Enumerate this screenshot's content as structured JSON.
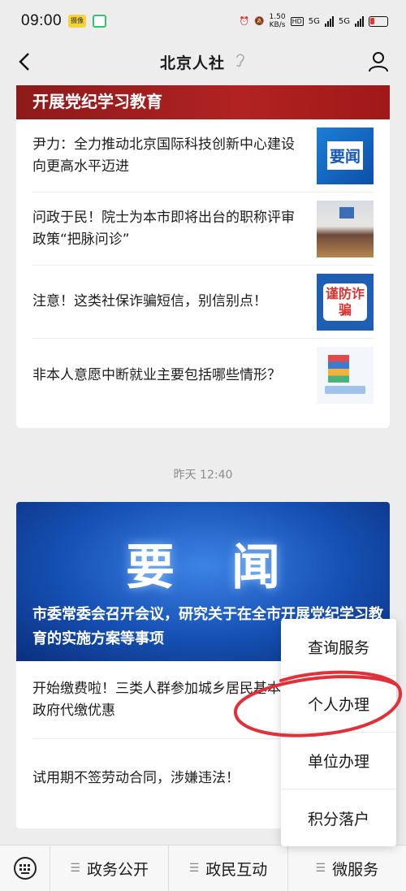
{
  "status_bar": {
    "time": "09:00",
    "chip_label": "摄像",
    "net_speed_value": "1.50",
    "net_speed_unit": "KB/s",
    "hd_label": "HD",
    "signal1_label": "5G",
    "signal2_label": "5G"
  },
  "header": {
    "title": "北京人社"
  },
  "card1": {
    "banner_text": "开展党纪学习教育",
    "items": [
      {
        "title": "尹力：全力推动北京国际科技创新中心建设向更高水平迈进",
        "thumb_label": "要闻"
      },
      {
        "title": "问政于民！院士为本市即将出台的职称评审政策“把脉问诊”"
      },
      {
        "title": "注意！这类社保诈骗短信，别信别点！",
        "thumb_label": "谨防诈骗"
      },
      {
        "title": "非本人意愿中断就业主要包括哪些情形？"
      }
    ]
  },
  "timestamp": "昨天 12:40",
  "card2": {
    "banner_big": "要闻",
    "banner_title": "市委常委会召开会议，研究关于在全市开展党纪学习教育的实施方案等事项",
    "items": [
      {
        "title": "开始缴费啦！三类人群参加城乡居民基本养老保险可享政府代缴优惠"
      },
      {
        "title": "试用期不签劳动合同，涉嫌违法！"
      }
    ]
  },
  "popup_menu": {
    "items": [
      "查询服务",
      "个人办理",
      "单位办理",
      "积分落户"
    ]
  },
  "bottom_bar": {
    "tabs": [
      "政务公开",
      "政民互动",
      "微服务"
    ]
  },
  "colors": {
    "banner_red": "#b22222",
    "banner_blue": "#1550b3",
    "annotation_red": "#e0303a"
  }
}
